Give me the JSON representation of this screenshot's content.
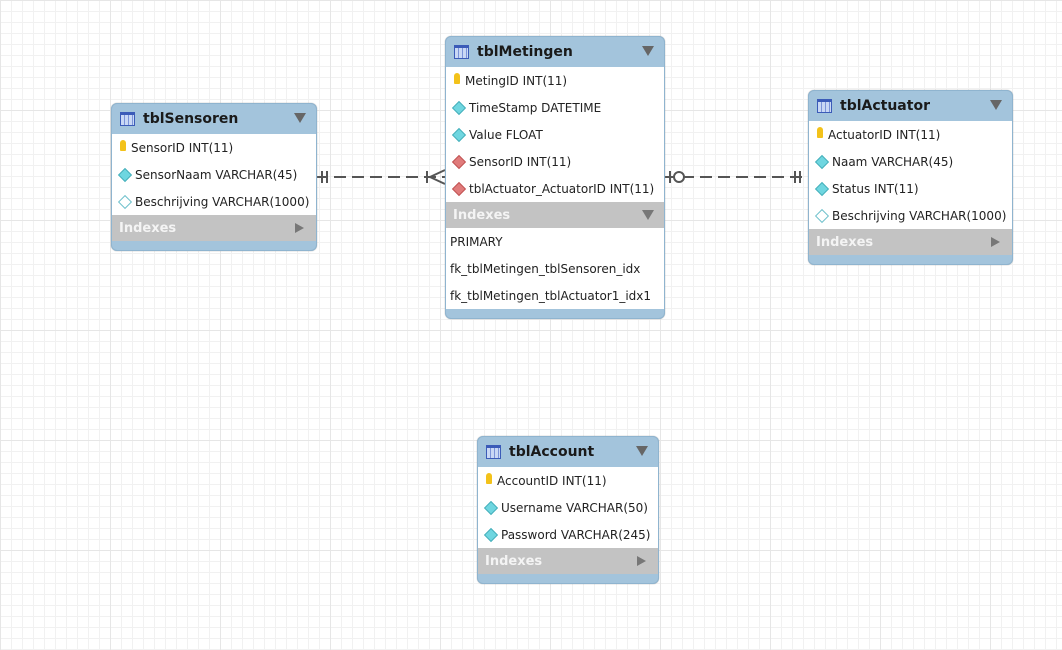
{
  "tables": {
    "sensoren": {
      "name": "tblSensoren",
      "columns": [
        {
          "label": "SensorID INT(11)",
          "kind": "pk"
        },
        {
          "label": "SensorNaam VARCHAR(45)",
          "kind": "nn"
        },
        {
          "label": "Beschrijving VARCHAR(1000)",
          "kind": "nul"
        }
      ],
      "indexes_label": "Indexes",
      "indexes": []
    },
    "metingen": {
      "name": "tblMetingen",
      "columns": [
        {
          "label": "MetingID INT(11)",
          "kind": "pk"
        },
        {
          "label": "TimeStamp DATETIME",
          "kind": "nn"
        },
        {
          "label": "Value FLOAT",
          "kind": "nn"
        },
        {
          "label": "SensorID INT(11)",
          "kind": "fk"
        },
        {
          "label": "tblActuator_ActuatorID INT(11)",
          "kind": "fk"
        }
      ],
      "indexes_label": "Indexes",
      "indexes": [
        "PRIMARY",
        "fk_tblMetingen_tblSensoren_idx",
        "fk_tblMetingen_tblActuator1_idx1"
      ]
    },
    "actuator": {
      "name": "tblActuator",
      "columns": [
        {
          "label": "ActuatorID INT(11)",
          "kind": "pk"
        },
        {
          "label": "Naam VARCHAR(45)",
          "kind": "nn"
        },
        {
          "label": "Status INT(11)",
          "kind": "nn"
        },
        {
          "label": "Beschrijving VARCHAR(1000)",
          "kind": "nul"
        }
      ],
      "indexes_label": "Indexes",
      "indexes": []
    },
    "account": {
      "name": "tblAccount",
      "columns": [
        {
          "label": "AccountID INT(11)",
          "kind": "pk"
        },
        {
          "label": "Username VARCHAR(50)",
          "kind": "nn"
        },
        {
          "label": "Password VARCHAR(245)",
          "kind": "nn"
        }
      ],
      "indexes_label": "Indexes",
      "indexes": []
    }
  },
  "relationships": [
    {
      "from": "tblSensoren",
      "to": "tblMetingen",
      "cardinality": "one-to-many"
    },
    {
      "from": "tblActuator",
      "to": "tblMetingen",
      "cardinality": "one-to-zero-or-one"
    }
  ]
}
